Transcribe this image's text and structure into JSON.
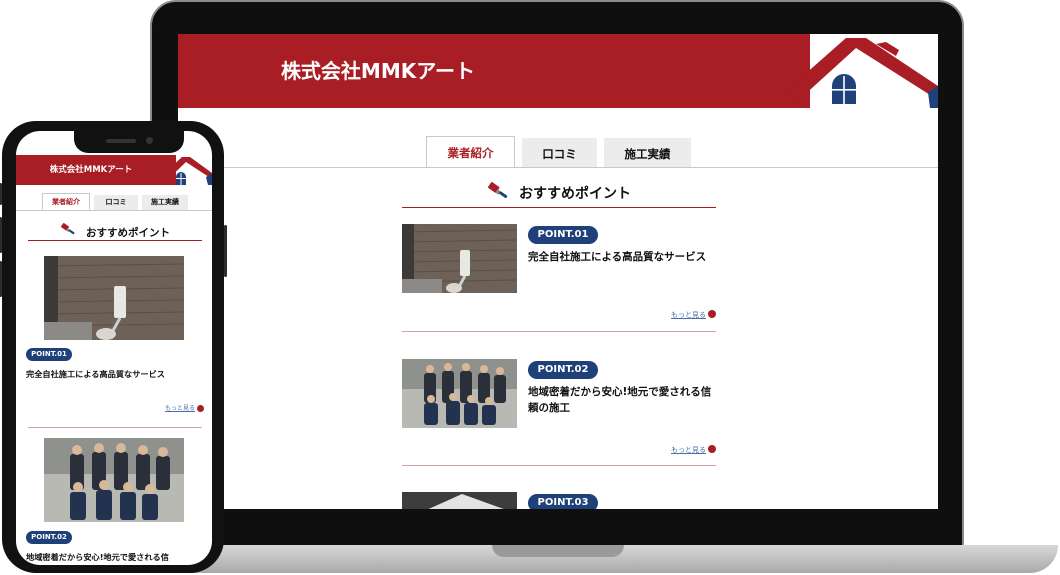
{
  "brand": {
    "primary": "#a81e24",
    "badge": "#1f4079"
  },
  "site": {
    "title": "株式会社MMKアート"
  },
  "tabs": [
    {
      "label": "業者紹介",
      "active": true
    },
    {
      "label": "口コミ",
      "active": false
    },
    {
      "label": "施工実績",
      "active": false
    }
  ],
  "section": {
    "title": "おすすめポイント",
    "icon": "paint-brush-icon"
  },
  "points": [
    {
      "badge": "POINT.01",
      "text": "完全自社施工による高品質なサービス",
      "more": "もっと見る",
      "image": "wall-painting-roller-photo"
    },
    {
      "badge": "POINT.02",
      "text": "地域密着だから安心!地元で愛される信頼の施工",
      "more": "もっと見る",
      "image": "team-group-photo"
    },
    {
      "badge": "POINT.03",
      "text": "",
      "more": "",
      "image": "partial-photo"
    }
  ],
  "phone": {
    "title": "株式会社MMKアート",
    "point2_text_partial": "地域密着だから安心!地元で愛される信"
  }
}
